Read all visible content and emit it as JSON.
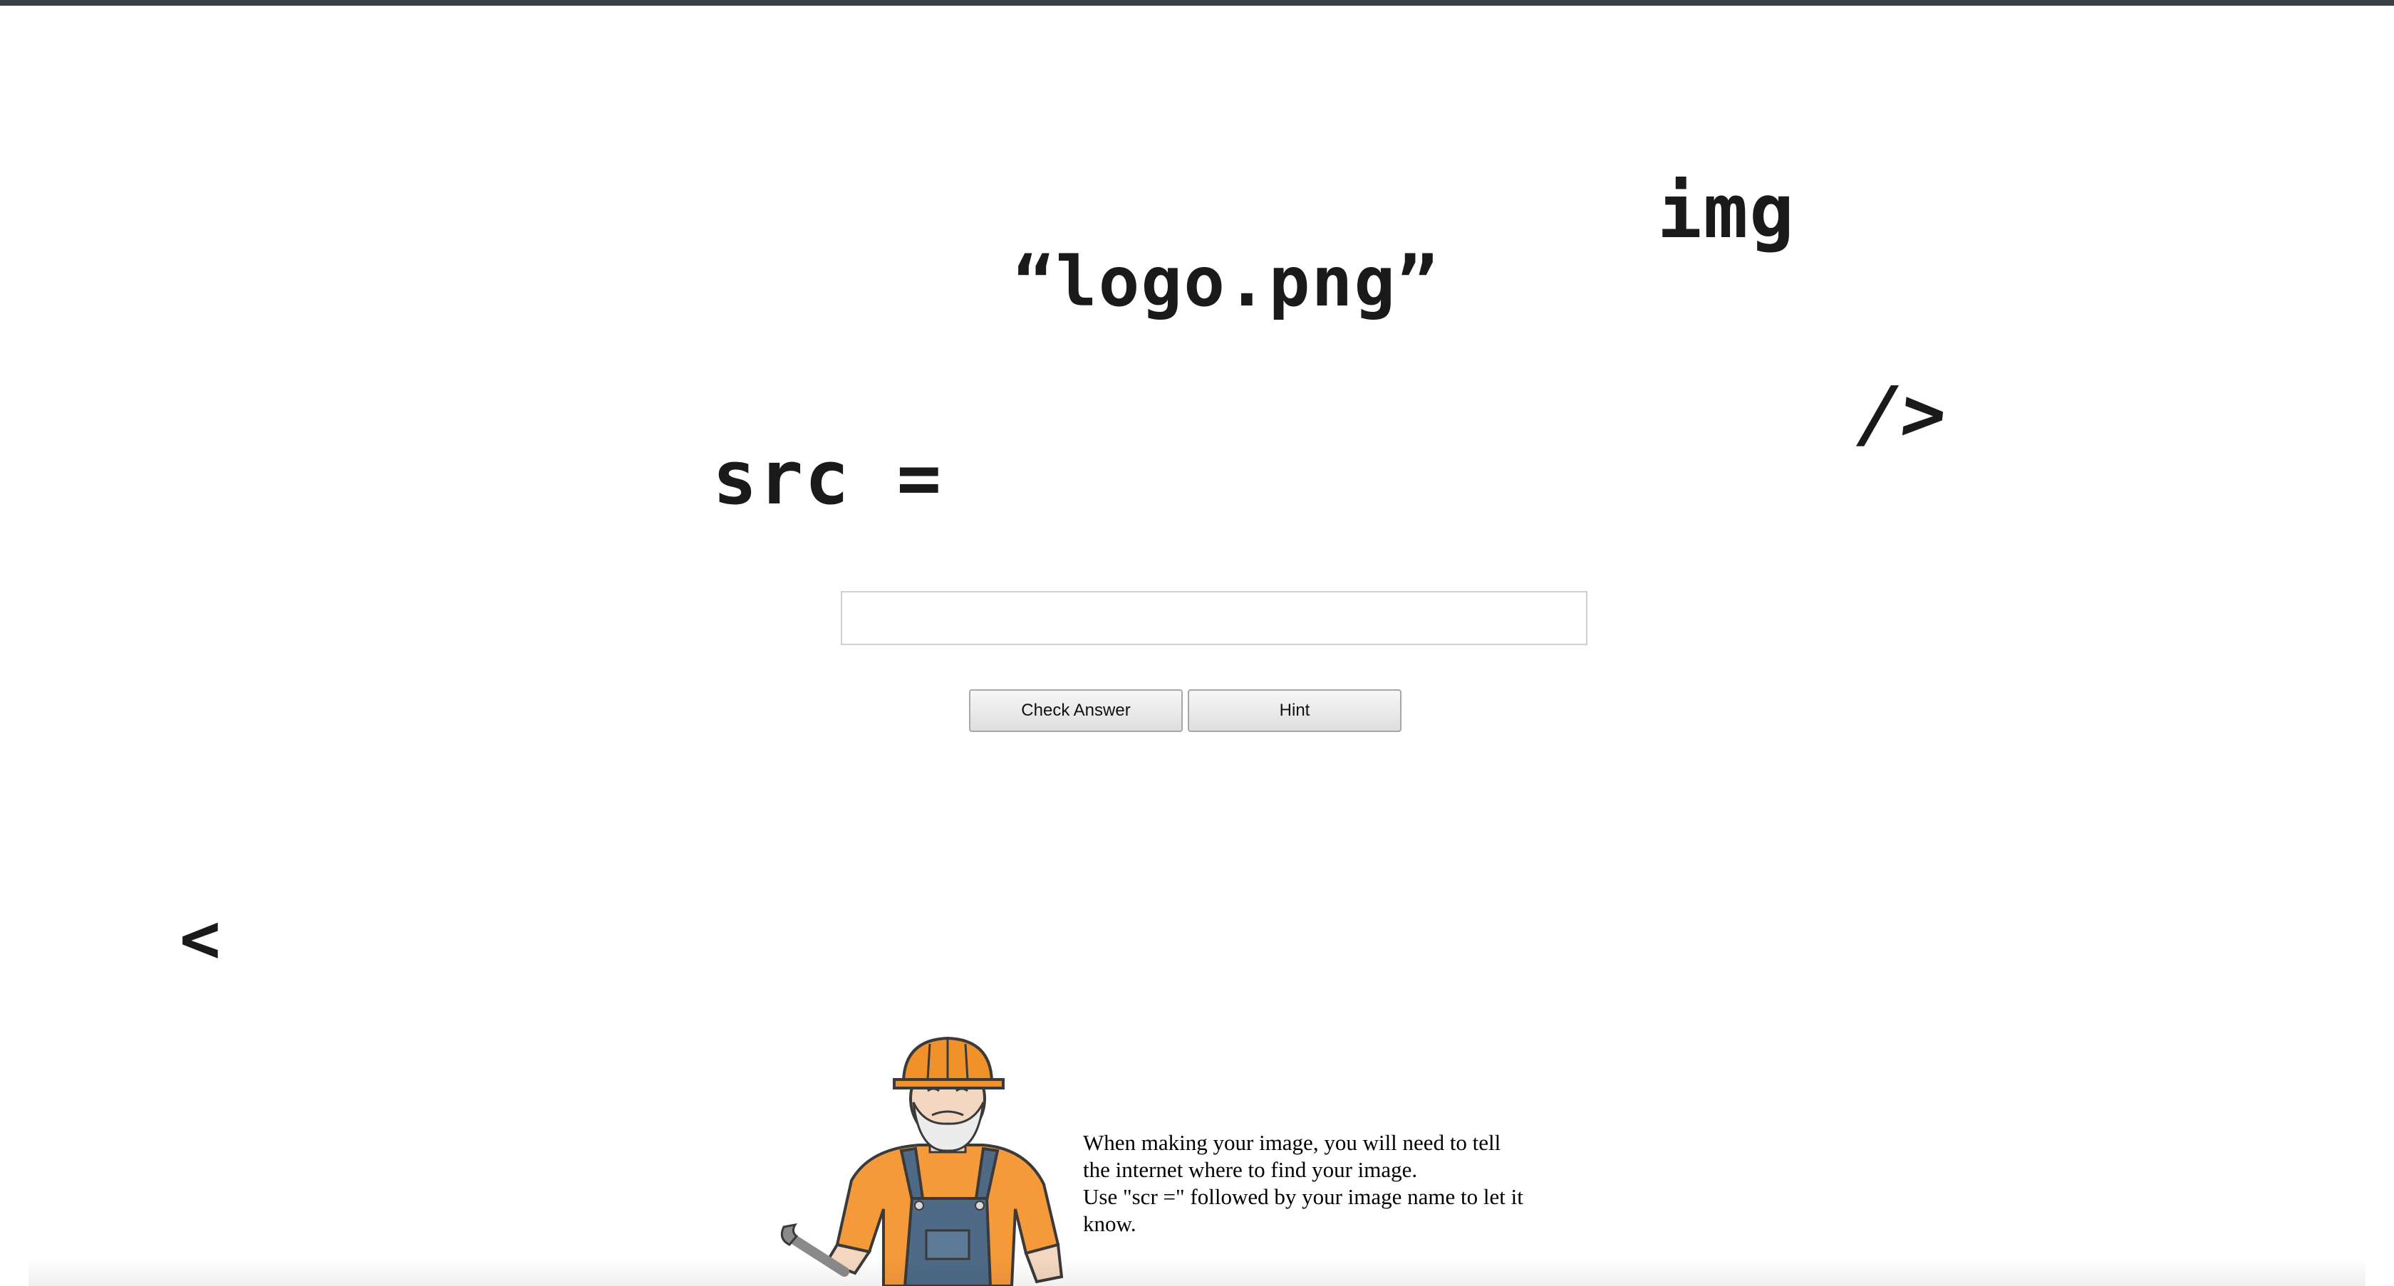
{
  "tokens": {
    "img": "img",
    "logo": "“logo.png”",
    "close": "/>",
    "src": "src =",
    "lt": "<"
  },
  "answer": {
    "value": "",
    "placeholder": ""
  },
  "buttons": {
    "check": "Check Answer",
    "hint": "Hint"
  },
  "helper": {
    "line1": "When making your image, you will need to tell the internet where to find your image.",
    "line2": "Use \"scr =\" followed by your image name to let it know."
  },
  "colors": {
    "helmet": "#f0912a",
    "shirt": "#f59a3a",
    "overalls": "#4e6a86",
    "outline": "#3a3a3a",
    "topbar": "#3b4045"
  },
  "icons": {
    "character": "construction-worker-illustration",
    "tool": "wrench-icon"
  }
}
